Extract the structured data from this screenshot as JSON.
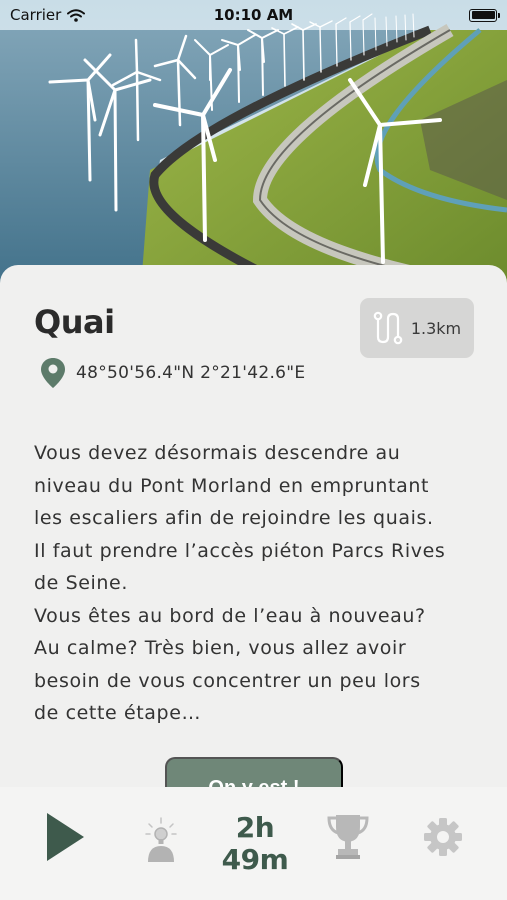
{
  "status_bar": {
    "carrier": "Carrier",
    "time": "10:10 AM"
  },
  "step": {
    "title": "Quai",
    "distance": "1.3km",
    "coordinates": "48°50'56.4\"N 2°21'42.6\"E",
    "description": "Vous devez désormais descendre au\nniveau du Pont Morland en empruntant\nles escaliers afin de rejoindre les quais.\nIl faut prendre l’accès piéton Parcs Rives\nde Seine.\nVous êtes au bord de l’eau à nouveau?\nAu calme? Très bien, vous allez avoir\nbesoin de vous concentrer un peu lors\nde cette étape…",
    "cta_label": "On y est !"
  },
  "tab_bar": {
    "timer_hours": "2h",
    "timer_minutes": "49m",
    "icons": [
      "play-icon",
      "hint-bulb-icon",
      "trophy-icon",
      "gear-icon"
    ]
  },
  "colors": {
    "accent_green": "#3e5a4c",
    "button_green": "#6f8778",
    "accent_yellow": "#f3d98a",
    "card_bg": "#f0f0ef"
  }
}
